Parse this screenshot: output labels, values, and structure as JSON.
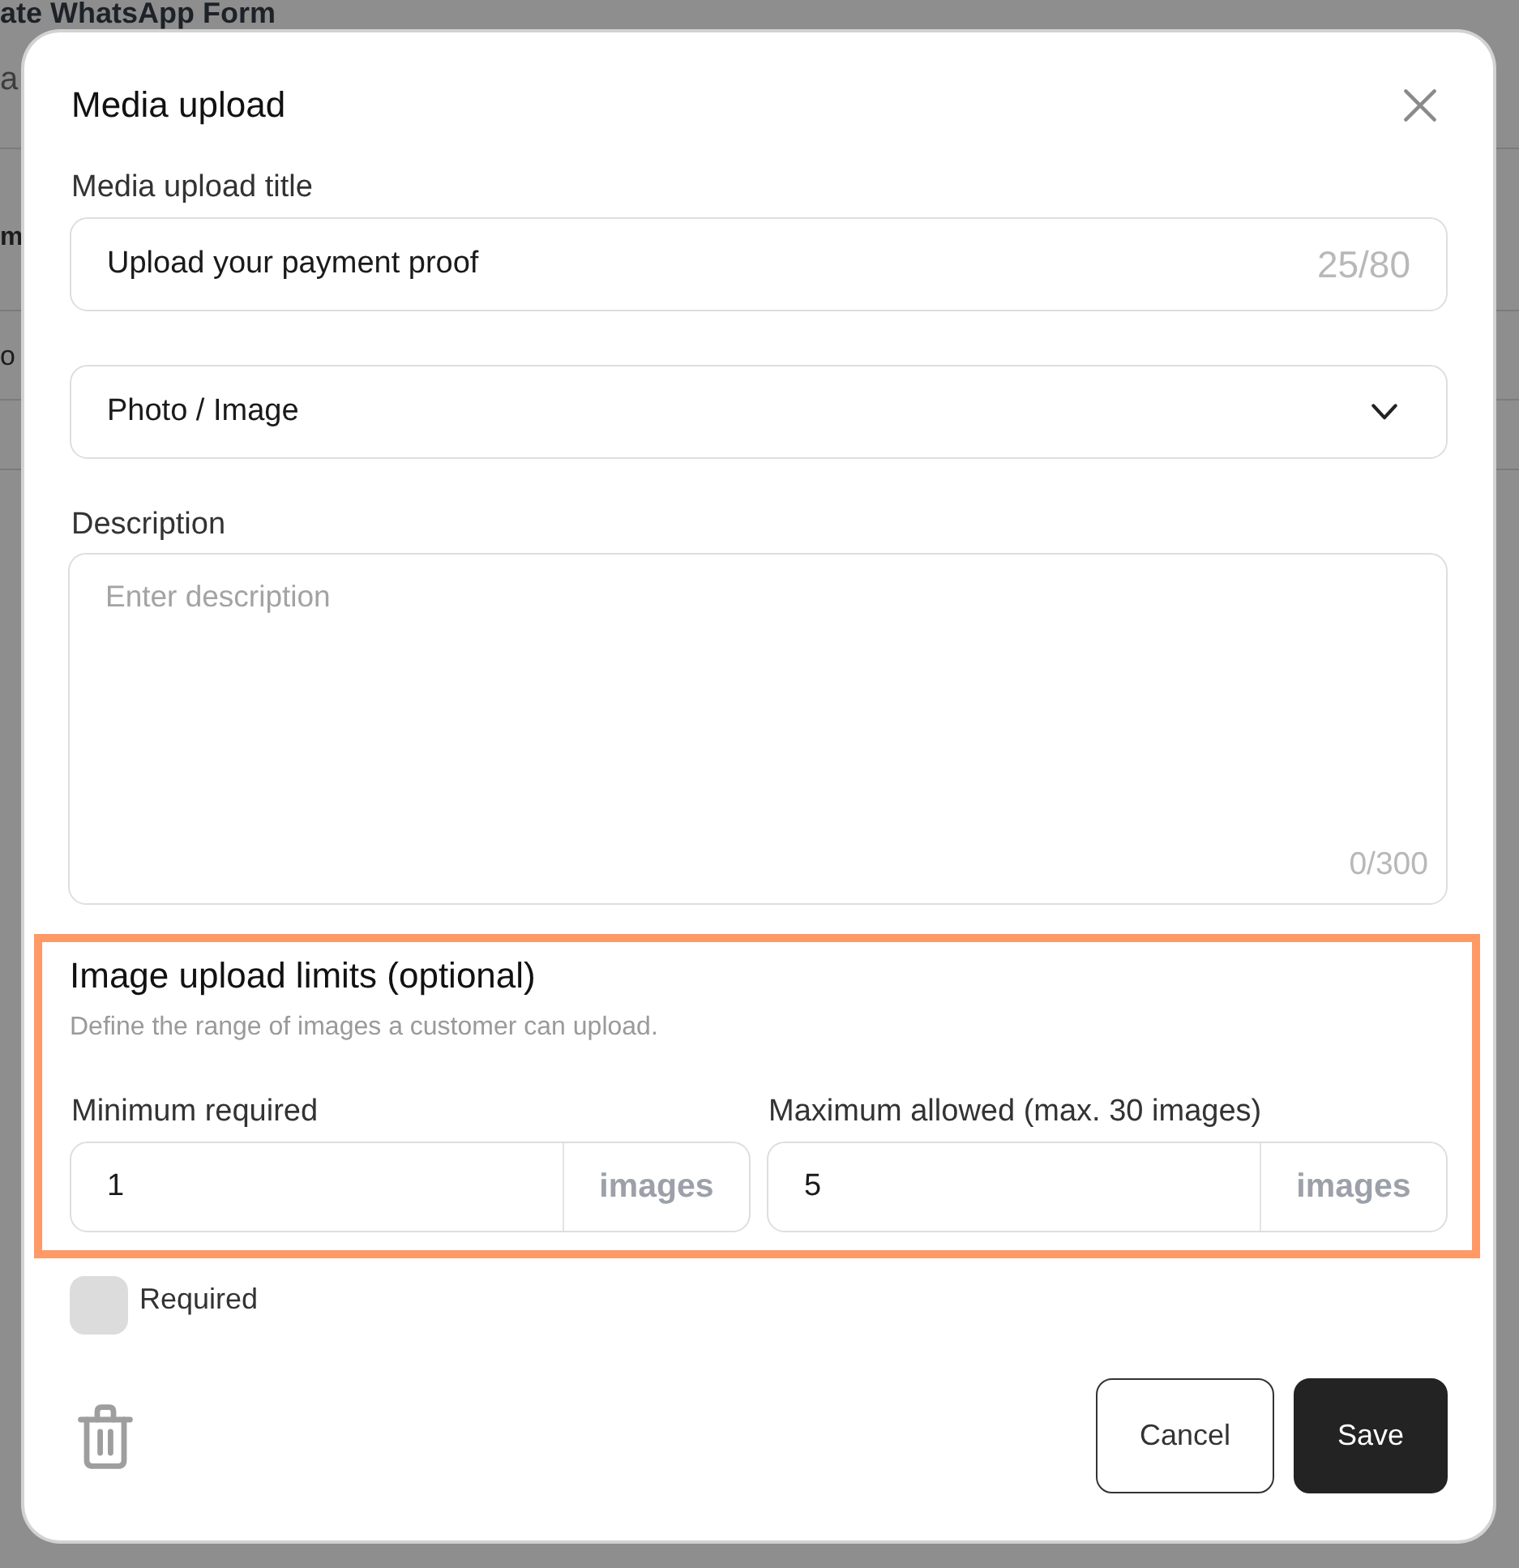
{
  "background": {
    "heading": "ate WhatsApp Form",
    "rows": [
      "a",
      "m",
      "o"
    ]
  },
  "dialog": {
    "title": "Media upload",
    "title_field": {
      "label": "Media upload title",
      "value": "Upload your payment proof",
      "counter": "25/80"
    },
    "media_type_select": {
      "value": "Photo / Image"
    },
    "description_field": {
      "label": "Description",
      "placeholder": "Enter description",
      "counter": "0/300"
    },
    "upload_limits": {
      "highlighted": true,
      "title": "Image upload limits (optional)",
      "hint": "Define the range of images a customer can upload.",
      "fields": [
        {
          "label": "Minimum required",
          "value": "1",
          "unit": "images"
        },
        {
          "label": "Maximum allowed (max. 30 images)",
          "value": "5",
          "unit": "images"
        }
      ]
    },
    "required_checkbox": {
      "label": "Required",
      "checked": false
    },
    "buttons": [
      {
        "label": "Cancel",
        "kind": "secondary"
      },
      {
        "label": "Save",
        "kind": "primary"
      }
    ]
  }
}
